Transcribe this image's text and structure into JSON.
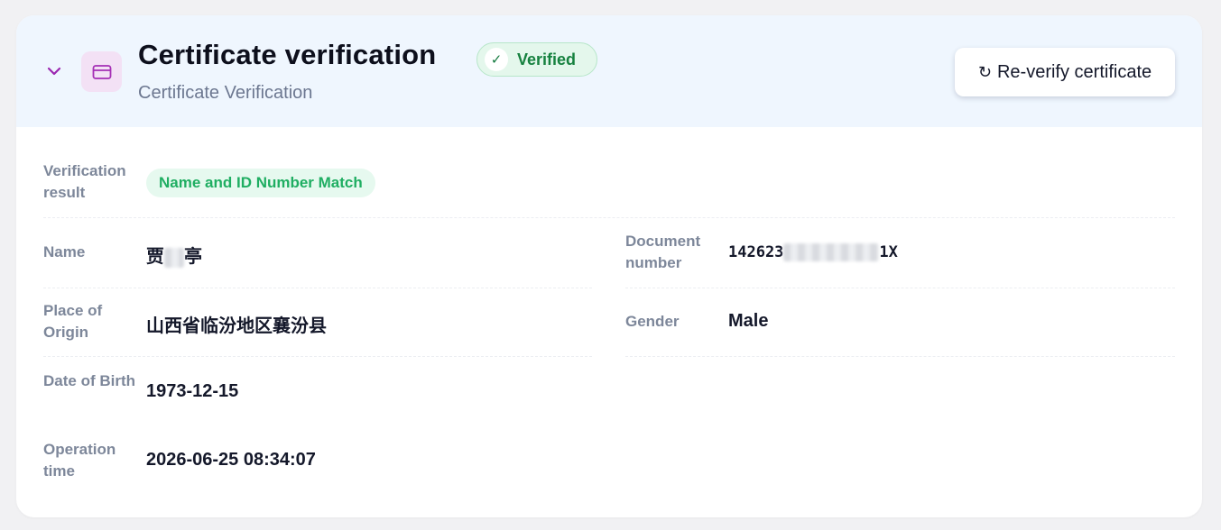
{
  "header": {
    "title": "Certificate verification",
    "badge": "Verified",
    "subtitle": "Certificate Verification",
    "reverify_label": "Re-verify certificate"
  },
  "fields": {
    "verification_result": {
      "label": "Verification result",
      "value": "Name and ID Number Match"
    },
    "name": {
      "label": "Name",
      "value_prefix": "贾",
      "value_suffix": "亭"
    },
    "document_number": {
      "label": "Document number",
      "value_prefix": "142623",
      "value_suffix": "1X"
    },
    "place_of_origin": {
      "label": "Place of Origin",
      "value": "山西省临汾地区襄汾县"
    },
    "gender": {
      "label": "Gender",
      "value": "Male"
    },
    "date_of_birth": {
      "label": "Date of Birth",
      "value": "1973-12-15"
    },
    "operation_time": {
      "label": "Operation time",
      "value": "2026-06-25 08:34:07"
    }
  },
  "icons": {
    "collapse": "chevron-down-icon",
    "type": "card-icon",
    "badge": "check-icon",
    "reverify": "refresh-icon"
  },
  "colors": {
    "accent_purple": "#9b27b0",
    "verified_green": "#16813f",
    "match_green": "#1fae62",
    "header_bg": "#eff6fe"
  }
}
